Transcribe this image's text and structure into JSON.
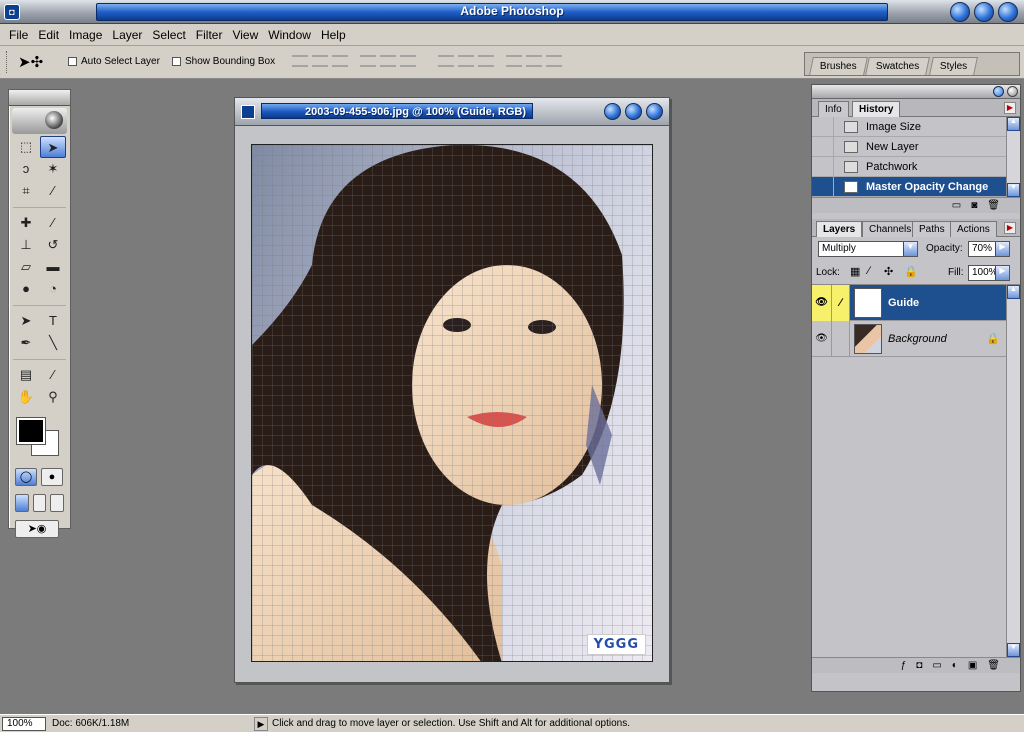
{
  "app": {
    "title": "Adobe Photoshop"
  },
  "menu": [
    "File",
    "Edit",
    "Image",
    "Layer",
    "Select",
    "Filter",
    "View",
    "Window",
    "Help"
  ],
  "options": {
    "auto_select_label": "Auto Select Layer",
    "bounding_label": "Show Bounding Box"
  },
  "palette_well": {
    "tabs": [
      "Brushes",
      "Swatches",
      "Styles"
    ]
  },
  "document": {
    "title": "2003-09-455-906.jpg @ 100% (Guide, RGB)",
    "watermark": "YGGG"
  },
  "history": {
    "tabs": [
      "Info",
      "History"
    ],
    "items": [
      "Image Size",
      "New Layer",
      "Patchwork",
      "Master Opacity Change"
    ]
  },
  "layers": {
    "tabs": [
      "Layers",
      "Channels",
      "Paths",
      "Actions"
    ],
    "blend_mode": "Multiply",
    "opacity_label": "Opacity:",
    "opacity": "70%",
    "lock_label": "Lock:",
    "fill_label": "Fill:",
    "fill": "100%",
    "rows": [
      {
        "name": "Guide"
      },
      {
        "name": "Background"
      }
    ]
  },
  "status": {
    "zoom": "100%",
    "doc": "Doc: 606K/1.18M",
    "hint": "Click and drag to move layer or selection.  Use Shift and Alt for additional options."
  },
  "colors": {
    "title_blue": "#1f5fc7",
    "selection_blue": "#1e4f8f",
    "highlight_yellow": "#f6f06b"
  }
}
